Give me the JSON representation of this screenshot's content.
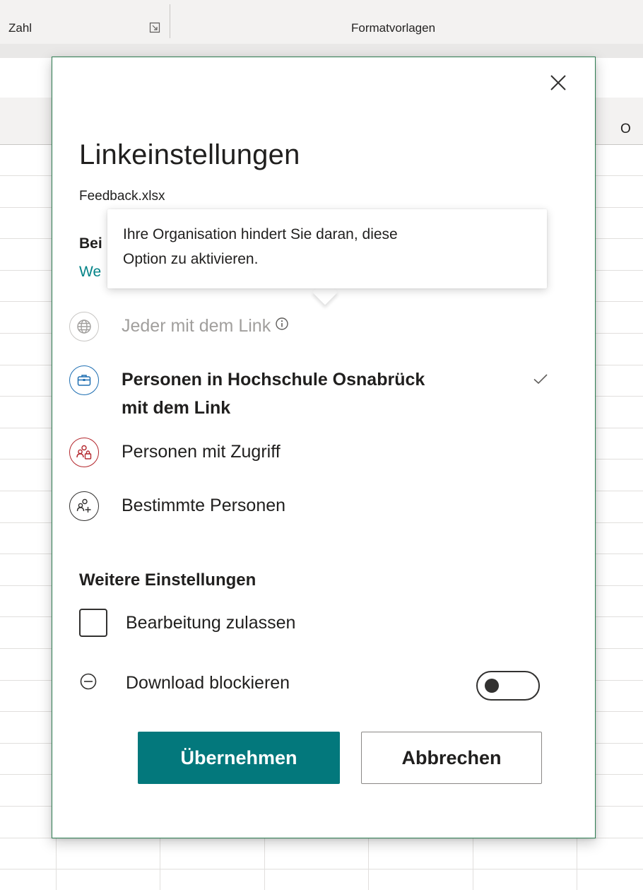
{
  "ribbon": {
    "group_number_label": "Zahl",
    "group_styles_label": "Formatvorlagen"
  },
  "sheet": {
    "column_letter": "O"
  },
  "dialog": {
    "title": "Linkeinstellungen",
    "file_name": "Feedback.xlsx",
    "section_peek": "Bei",
    "link_peek": "We",
    "options": [
      {
        "label": "Jeder mit dem Link",
        "icon": "globe-icon",
        "state": "disabled",
        "info_icon": true
      },
      {
        "label": "Personen in Hochschule Osnabrück",
        "label_line2": "mit dem Link",
        "icon": "briefcase-icon",
        "state": "selected"
      },
      {
        "label": "Personen mit Zugriff",
        "icon": "people-lock-icon",
        "state": "normal"
      },
      {
        "label": "Bestimmte Personen",
        "icon": "people-add-icon",
        "state": "normal"
      }
    ],
    "more_settings_heading": "Weitere Einstellungen",
    "allow_editing_label": "Bearbeitung zulassen",
    "allow_editing_checked": false,
    "block_download_label": "Download blockieren",
    "block_download_on": false,
    "apply_label": "Übernehmen",
    "cancel_label": "Abbrechen"
  },
  "tooltip": {
    "text_line1": "Ihre Organisation hindert Sie daran, diese",
    "text_line2": "Option zu aktivieren."
  },
  "colors": {
    "primary": "#03787c",
    "link": "#038387",
    "selected_icon": "#1f6fb2",
    "people_lock_icon": "#b4282e",
    "disabled": "#a19f9d",
    "dialog_border": "#2e7d52"
  }
}
